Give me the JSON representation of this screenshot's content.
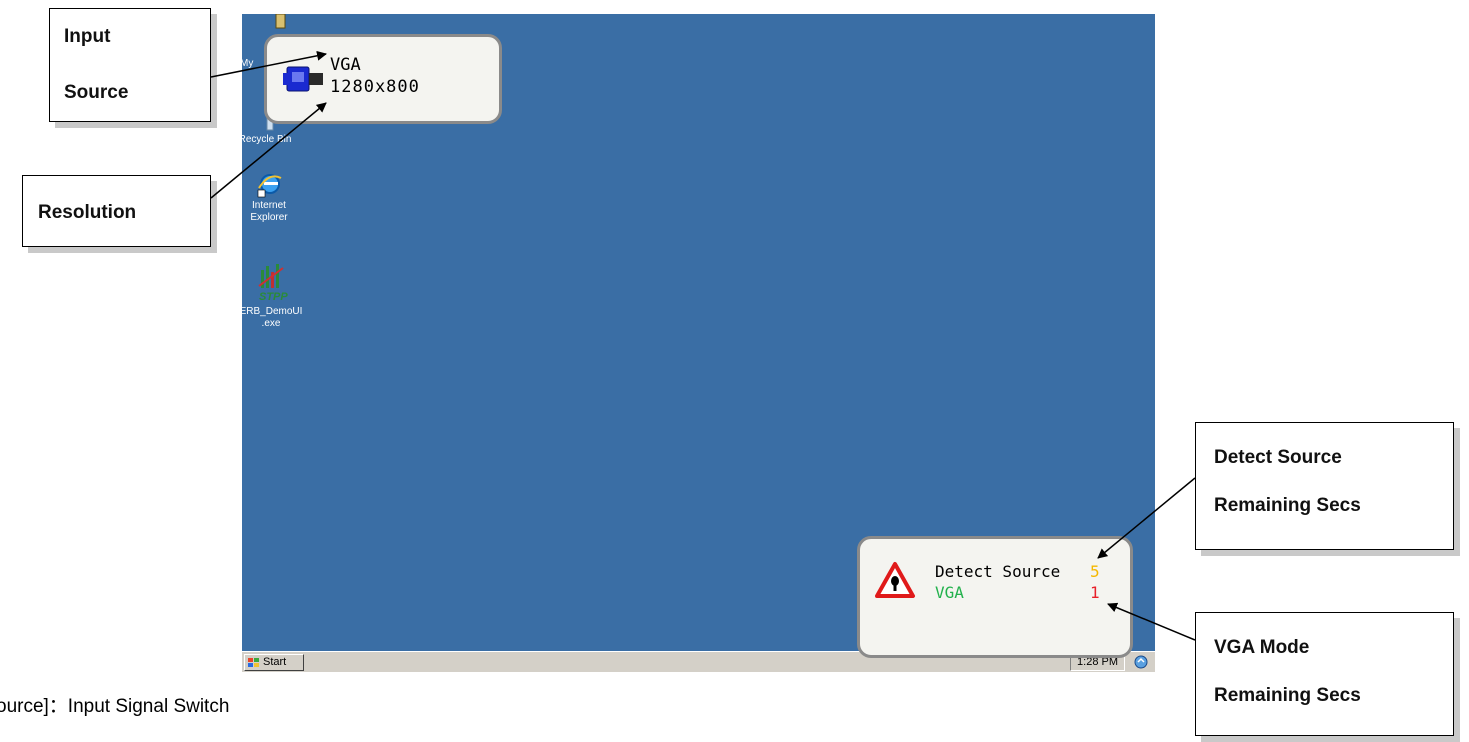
{
  "desktop": {
    "icons": [
      {
        "label": "My",
        "icon": "my-computer-icon"
      },
      {
        "label": "Recycle Bin",
        "icon": "recycle-bin-icon"
      },
      {
        "label": "Internet\nExplorer",
        "icon": "internet-explorer-icon"
      },
      {
        "label": "ERB_DemoUI\n.exe",
        "icon": "erb-demoui-icon"
      }
    ]
  },
  "osd_input": {
    "source": "VGA",
    "resolution": "1280x800",
    "icon": "vga-connector-icon"
  },
  "osd_detect": {
    "title": "Detect Source",
    "title_secs": "5",
    "mode": "VGA",
    "mode_secs": "1",
    "icon": "warning-triangle-icon",
    "colors": {
      "title_secs": "#f5b800",
      "mode": "#22b14c",
      "mode_secs": "#e8202a"
    }
  },
  "taskbar": {
    "start_label": "Start",
    "clock": "1:28 PM",
    "tray_icon": "network-icon"
  },
  "callouts": {
    "input_source": [
      "Input",
      "Source"
    ],
    "resolution": "Resolution",
    "detect_source": [
      "Detect Source",
      "Remaining Secs"
    ],
    "vga_mode": [
      "VGA Mode",
      "Remaining Secs"
    ]
  },
  "caption": "ource]：Input Signal Switch"
}
